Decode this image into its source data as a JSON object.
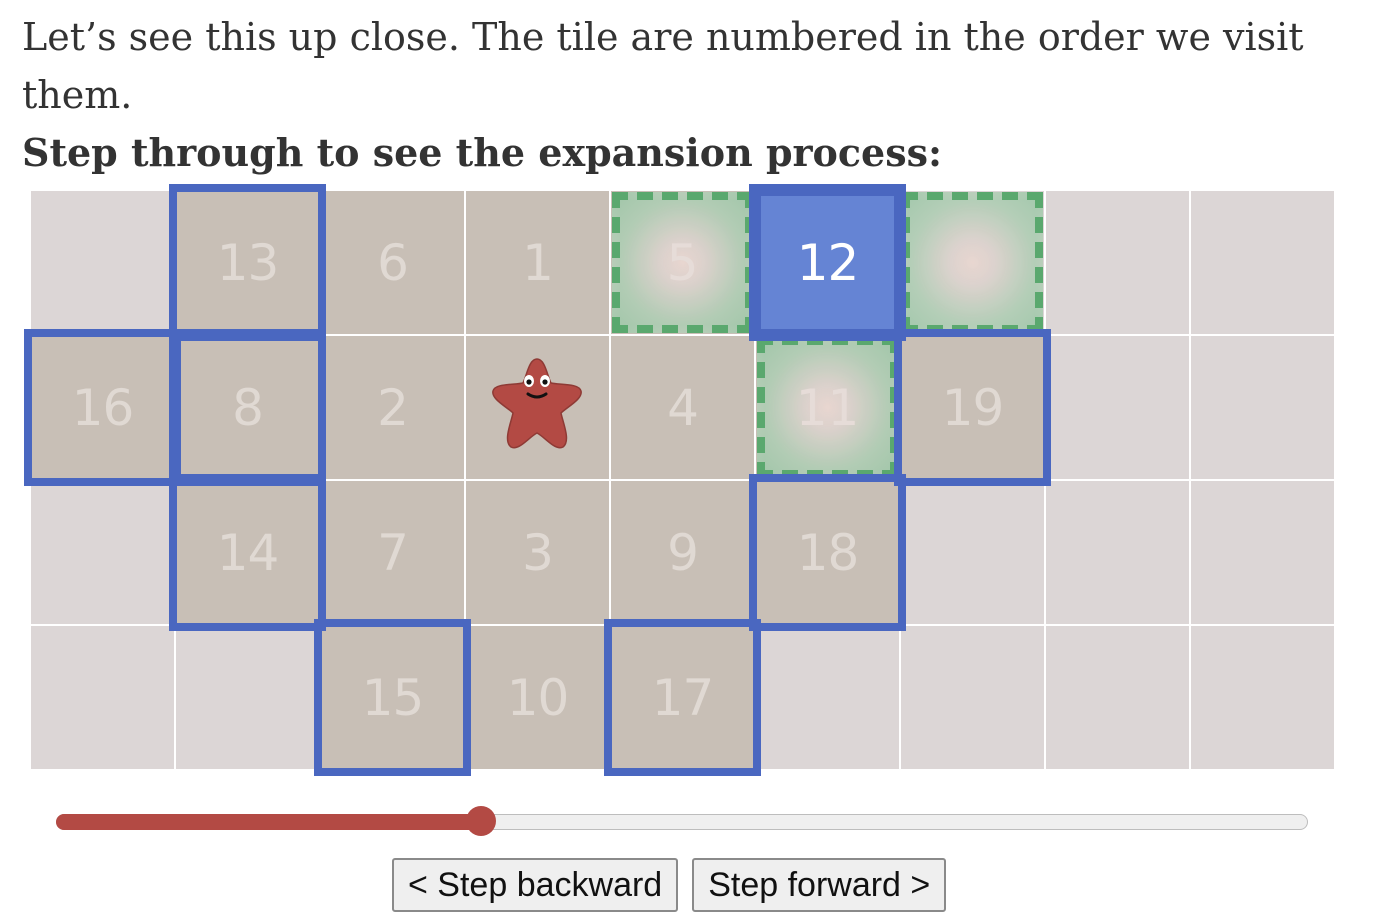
{
  "intro": {
    "line1": "Let’s see this up close. The tile are numbered in the order we visit them.",
    "line2": "Step through to see the expansion process:"
  },
  "grid": {
    "cols": 9,
    "rows": 4,
    "tiles": [
      {
        "col": 0,
        "row": 0,
        "state": "empty",
        "label": ""
      },
      {
        "col": 1,
        "row": 0,
        "state": "visited",
        "label": "13"
      },
      {
        "col": 2,
        "row": 0,
        "state": "visited",
        "label": "6"
      },
      {
        "col": 3,
        "row": 0,
        "state": "visited",
        "label": "1"
      },
      {
        "col": 4,
        "row": 0,
        "state": "visited",
        "label": "5"
      },
      {
        "col": 5,
        "row": 0,
        "state": "current",
        "label": "12"
      },
      {
        "col": 6,
        "row": 0,
        "state": "empty",
        "label": ""
      },
      {
        "col": 7,
        "row": 0,
        "state": "empty",
        "label": ""
      },
      {
        "col": 8,
        "row": 0,
        "state": "empty",
        "label": ""
      },
      {
        "col": 0,
        "row": 1,
        "state": "visited",
        "label": "16"
      },
      {
        "col": 1,
        "row": 1,
        "state": "visited",
        "label": "8"
      },
      {
        "col": 2,
        "row": 1,
        "state": "visited",
        "label": "2"
      },
      {
        "col": 3,
        "row": 1,
        "state": "visited",
        "label": ""
      },
      {
        "col": 4,
        "row": 1,
        "state": "visited",
        "label": "4"
      },
      {
        "col": 5,
        "row": 1,
        "state": "visited",
        "label": "11"
      },
      {
        "col": 6,
        "row": 1,
        "state": "visited",
        "label": "19"
      },
      {
        "col": 7,
        "row": 1,
        "state": "empty",
        "label": ""
      },
      {
        "col": 8,
        "row": 1,
        "state": "empty",
        "label": ""
      },
      {
        "col": 0,
        "row": 2,
        "state": "empty",
        "label": ""
      },
      {
        "col": 1,
        "row": 2,
        "state": "visited",
        "label": "14"
      },
      {
        "col": 2,
        "row": 2,
        "state": "visited",
        "label": "7"
      },
      {
        "col": 3,
        "row": 2,
        "state": "visited",
        "label": "3"
      },
      {
        "col": 4,
        "row": 2,
        "state": "visited",
        "label": "9"
      },
      {
        "col": 5,
        "row": 2,
        "state": "visited",
        "label": "18"
      },
      {
        "col": 6,
        "row": 2,
        "state": "empty",
        "label": ""
      },
      {
        "col": 7,
        "row": 2,
        "state": "empty",
        "label": ""
      },
      {
        "col": 8,
        "row": 2,
        "state": "empty",
        "label": ""
      },
      {
        "col": 0,
        "row": 3,
        "state": "empty",
        "label": ""
      },
      {
        "col": 1,
        "row": 3,
        "state": "empty",
        "label": ""
      },
      {
        "col": 2,
        "row": 3,
        "state": "visited",
        "label": "15"
      },
      {
        "col": 3,
        "row": 3,
        "state": "visited",
        "label": "10"
      },
      {
        "col": 4,
        "row": 3,
        "state": "visited",
        "label": "17"
      },
      {
        "col": 5,
        "row": 3,
        "state": "empty",
        "label": ""
      },
      {
        "col": 6,
        "row": 3,
        "state": "empty",
        "label": ""
      },
      {
        "col": 7,
        "row": 3,
        "state": "empty",
        "label": ""
      },
      {
        "col": 8,
        "row": 3,
        "state": "empty",
        "label": ""
      }
    ],
    "frontier": [
      {
        "col": 1,
        "row": 0
      },
      {
        "col": 0,
        "row": 1
      },
      {
        "col": 1,
        "row": 1
      },
      {
        "col": 6,
        "row": 1
      },
      {
        "col": 1,
        "row": 2
      },
      {
        "col": 5,
        "row": 2
      },
      {
        "col": 2,
        "row": 3
      },
      {
        "col": 4,
        "row": 3
      }
    ],
    "current": {
      "col": 5,
      "row": 0
    },
    "neighbors": [
      {
        "col": 4,
        "row": 0,
        "label": "5"
      },
      {
        "col": 6,
        "row": 0,
        "label": ""
      },
      {
        "col": 5,
        "row": 1,
        "label": "11"
      }
    ],
    "start": {
      "col": 3,
      "row": 1,
      "icon": "starfish-blob-icon"
    }
  },
  "slider": {
    "progress": 0.34,
    "fill_color": "#b34a44"
  },
  "buttons": {
    "back_label": "< Step backward",
    "forward_label": "Step forward >"
  },
  "colors": {
    "frontier": "#4a67c0",
    "neighbor": "#5aa86e",
    "current": "#6584d4",
    "visited": "#c8bfb6",
    "empty": "#dcd6d6"
  }
}
